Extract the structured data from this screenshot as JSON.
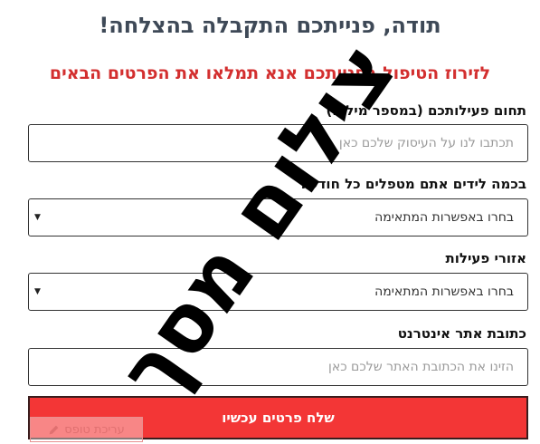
{
  "form": {
    "title": "תודה, פנייתכם התקבלה בהצלחה!",
    "subtitle": "לזירוז הטיפול בפנייתכם אנא תמלאו את הפרטים הבאים",
    "fields": [
      {
        "label": "תחום פעילותכם (במספר מילים)",
        "placeholder": "תכתבו לנו על העיסוק שלכם כאן"
      },
      {
        "label": "בכמה לידים אתם מטפלים כל חודש?",
        "value": "בחרו באפשרות המתאימה",
        "caret": "▼"
      },
      {
        "label": "אזורי פעילות",
        "value": "בחרו באפשרות המתאימה",
        "caret": "▼"
      },
      {
        "label": "כתובת אתר אינטרנט",
        "placeholder": "הזינו את הכתובת האתר שלכם כאן"
      }
    ],
    "submit_label": "שלח פרטים עכשיו",
    "edit_label": "עריכת טופס"
  },
  "watermark": {
    "text": "צילום מסך",
    "icon": "pencil-icon"
  }
}
